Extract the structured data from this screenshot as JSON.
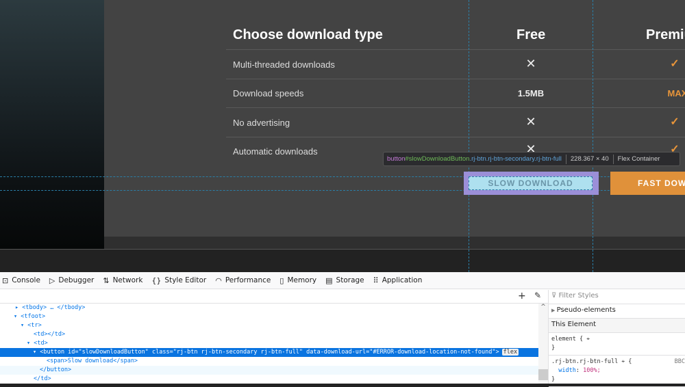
{
  "page": {
    "heading": "Choose download type",
    "columns": [
      "Free",
      "Premium"
    ],
    "rows": [
      {
        "label": "Multi-threaded downloads",
        "free": "✕",
        "premium": "✓"
      },
      {
        "label": "Download speeds",
        "free": "1.5MB",
        "premium": "MAX"
      },
      {
        "label": "No advertising",
        "free": "✕",
        "premium": "✓"
      },
      {
        "label": "Automatic downloads",
        "free": "✕",
        "premium": "✓"
      }
    ],
    "slow_button": "SLOW DOWNLOAD",
    "fast_button": "FAST DOWNLOAD",
    "accent": "#e0913a"
  },
  "tooltip": {
    "tag": "button",
    "id": "#slowDownloadButton",
    "classes": ".rj-btn.rj-btn-secondary.rj-btn-full",
    "size": "228.367 × 40",
    "type": "Flex Container"
  },
  "devtools": {
    "tabs": [
      {
        "icon": "console-icon",
        "label": "Console"
      },
      {
        "icon": "debugger-icon",
        "label": "Debugger"
      },
      {
        "icon": "network-icon",
        "label": "Network"
      },
      {
        "icon": "style-editor-icon",
        "label": "Style Editor"
      },
      {
        "icon": "performance-icon",
        "label": "Performance"
      },
      {
        "icon": "memory-icon",
        "label": "Memory"
      },
      {
        "icon": "storage-icon",
        "label": "Storage"
      },
      {
        "icon": "application-icon",
        "label": "Application"
      }
    ],
    "tree": [
      "▸ <tbody> … </tbody>",
      "▾ <tfoot>",
      "▾ <tr>",
      "<td></td>",
      "▾ <td>",
      "▾ <button id=\"slowDownloadButton\" class=\"rj-btn rj-btn-secondary rj-btn-full\" data-download-url=\"#ERROR-download-location-not-found\">",
      "<span>Slow download</span>",
      "</button>",
      "</td>"
    ],
    "flex_badge": "flex",
    "rules": {
      "filter_placeholder": "Filter Styles",
      "pseudo": "Pseudo-elements",
      "this_element": "This Element",
      "element_open": "element {",
      "close": "}",
      "selector": ".rj-btn.rj-btn-full",
      "source": "BBC",
      "prop": "width",
      "value": "100%;"
    }
  }
}
